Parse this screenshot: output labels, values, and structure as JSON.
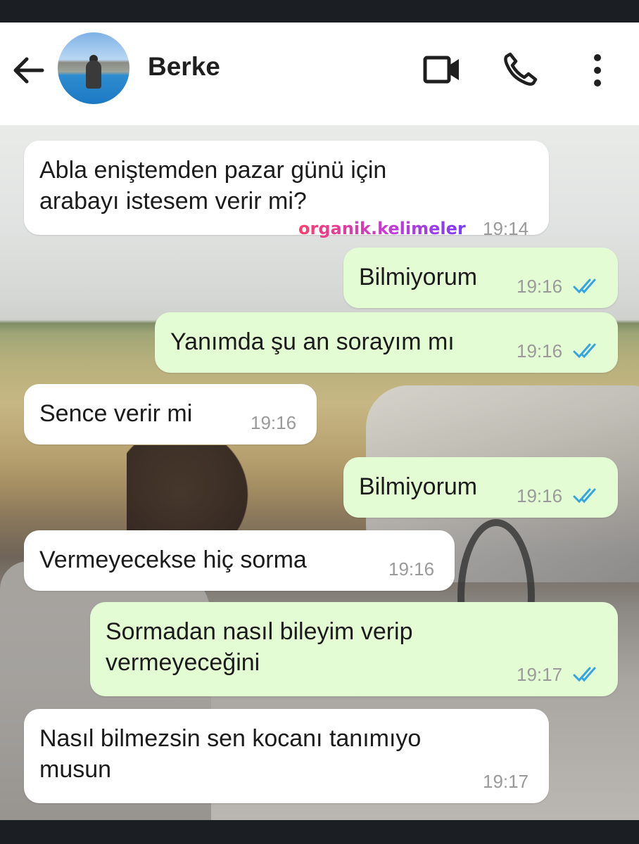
{
  "header": {
    "contact_name": "Berke",
    "icons": {
      "back": "arrow-left-icon",
      "avatar": "avatar",
      "video": "video-camera-icon",
      "call": "phone-icon",
      "menu": "more-vertical-icon"
    }
  },
  "watermark": "organik.kelimeler",
  "messages": [
    {
      "direction": "incoming",
      "text": "Abla eniştemden pazar günü için\narabayı istesem verir mi?",
      "time": "19:14",
      "read": false
    },
    {
      "direction": "outgoing",
      "text": "Bilmiyorum",
      "time": "19:16",
      "read": true
    },
    {
      "direction": "outgoing",
      "text": "Yanımda şu an sorayım mı",
      "time": "19:16",
      "read": true
    },
    {
      "direction": "incoming",
      "text": "Sence verir mi",
      "time": "19:16",
      "read": false
    },
    {
      "direction": "outgoing",
      "text": "Bilmiyorum",
      "time": "19:16",
      "read": true
    },
    {
      "direction": "incoming",
      "text": "Vermeyecekse hiç sorma",
      "time": "19:16",
      "read": false
    },
    {
      "direction": "outgoing",
      "text": "Sormadan nasıl bileyim verip\nvermeyeceğini",
      "time": "19:17",
      "read": true
    },
    {
      "direction": "incoming",
      "text": "Nasıl bilmezsin sen kocanı tanımıyo\nmusun",
      "time": "19:17",
      "read": false
    }
  ],
  "colors": {
    "incoming_bubble": "#ffffff",
    "outgoing_bubble": "#e3fcd4",
    "read_ticks": "#34a5e0",
    "timestamp": "#9a9a9a"
  }
}
